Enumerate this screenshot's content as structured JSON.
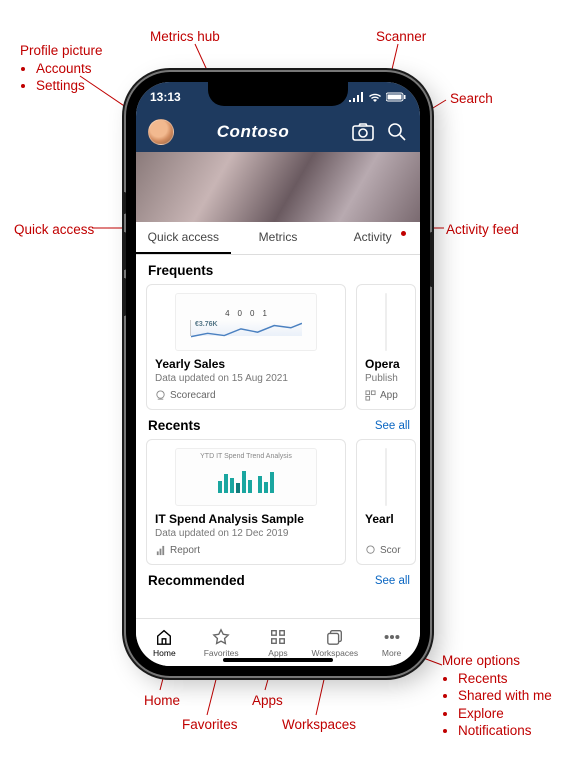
{
  "annotations": {
    "profile_picture": {
      "title": "Profile picture",
      "items": [
        "Accounts",
        "Settings"
      ]
    },
    "metrics_hub": "Metrics hub",
    "scanner": "Scanner",
    "search": "Search",
    "quick_access": "Quick access",
    "activity_feed": "Activity feed",
    "home": "Home",
    "favorites": "Favorites",
    "apps": "Apps",
    "workspaces": "Workspaces",
    "more_options": {
      "title": "More options",
      "items": [
        "Recents",
        "Shared with me",
        "Explore",
        "Notifications"
      ]
    }
  },
  "statusbar": {
    "time": "13:13"
  },
  "header": {
    "brand": "Contoso"
  },
  "tabs": {
    "quick_access": "Quick access",
    "metrics": "Metrics",
    "activity": "Activity"
  },
  "sections": {
    "frequents": {
      "title": "Frequents",
      "cards": [
        {
          "title": "Yearly Sales",
          "subtitle": "Data updated on 15 Aug 2021",
          "type": "Scorecard",
          "thumb_kpi": "€3.76K",
          "thumb_scores": [
            "4",
            "0",
            "0",
            "1"
          ]
        },
        {
          "title": "Opera",
          "subtitle": "Publish",
          "type": "App"
        }
      ]
    },
    "recents": {
      "title": "Recents",
      "see_all": "See all",
      "cards": [
        {
          "title": "IT Spend Analysis Sample",
          "subtitle": "Data updated on 12 Dec 2019",
          "type": "Report",
          "thumb_title": "YTD IT Spend Trend Analysis"
        },
        {
          "title": "Yearl",
          "subtitle": "",
          "type": "Scor"
        }
      ]
    },
    "recommended": {
      "title": "Recommended",
      "see_all": "See all"
    }
  },
  "bottomnav": {
    "home": "Home",
    "favorites": "Favorites",
    "apps": "Apps",
    "workspaces": "Workspaces",
    "more": "More"
  }
}
